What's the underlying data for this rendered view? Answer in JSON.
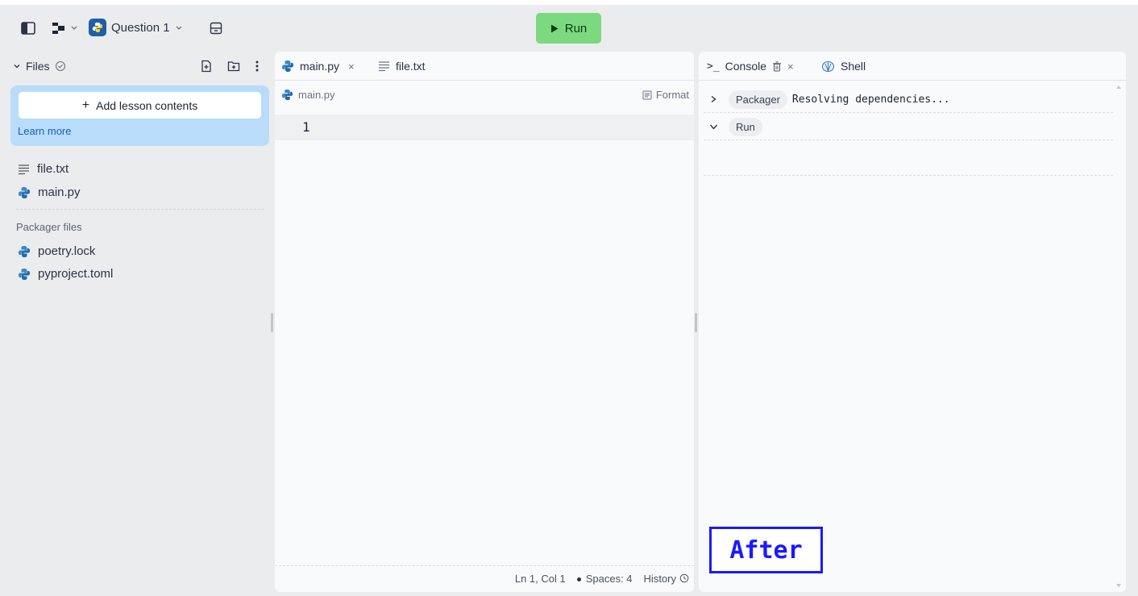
{
  "topbar": {
    "repl_name": "Question 1",
    "run_label": "Run"
  },
  "files": {
    "header": "Files",
    "add_lesson_label": "Add lesson contents",
    "learn_more": "Learn more",
    "items": [
      {
        "name": "file.txt",
        "icon": "text-file-icon"
      },
      {
        "name": "main.py",
        "icon": "python-icon"
      }
    ],
    "packager_label": "Packager files",
    "packager_items": [
      {
        "name": "poetry.lock",
        "icon": "python-icon"
      },
      {
        "name": "pyproject.toml",
        "icon": "python-icon"
      }
    ]
  },
  "editor": {
    "tabs": [
      {
        "label": "main.py",
        "icon": "python-icon",
        "active": true
      },
      {
        "label": "file.txt",
        "icon": "text-file-icon",
        "active": false
      }
    ],
    "path": "main.py",
    "format_label": "Format",
    "line_number": "1",
    "status": {
      "position": "Ln 1, Col 1",
      "spaces": "Spaces: 4",
      "history": "History"
    }
  },
  "console": {
    "tabs": [
      {
        "label": "Console",
        "icon": "terminal-icon"
      },
      {
        "label": "Shell",
        "icon": "shell-icon"
      }
    ],
    "rows": [
      {
        "pill": "Packager",
        "text": "Resolving dependencies..."
      },
      {
        "pill": "Run",
        "text": ""
      }
    ]
  },
  "overlay": {
    "label": "After",
    "color": "#1a1aff"
  },
  "colors": {
    "run_button": "#7bd97f",
    "lesson_box": "#b8dcf9",
    "python_badge": "#1f5fa8"
  }
}
